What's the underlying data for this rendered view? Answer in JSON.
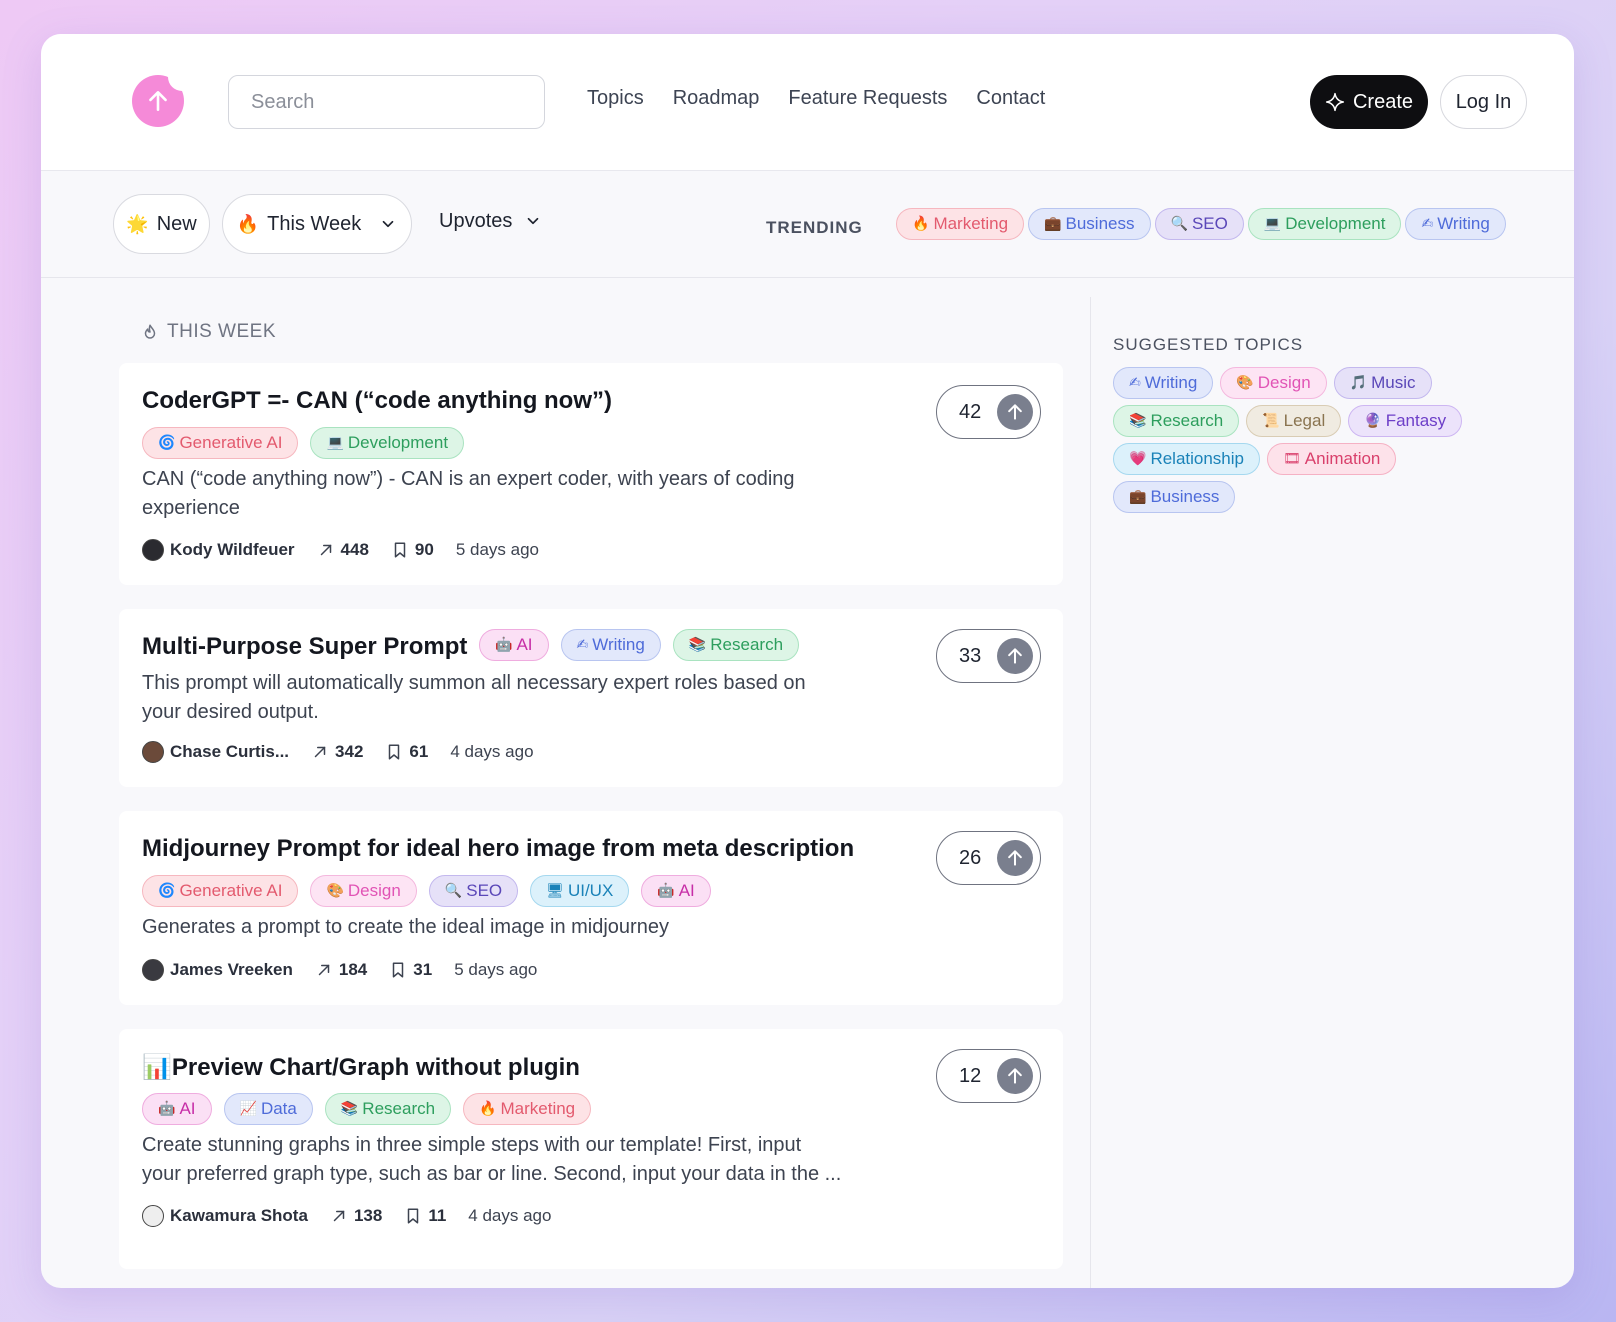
{
  "header": {
    "search_placeholder": "Search",
    "nav": [
      "Topics",
      "Roadmap",
      "Feature Requests",
      "Contact"
    ],
    "create_label": "Create",
    "login_label": "Log In"
  },
  "filters": {
    "new_label": "New",
    "new_emoji": "🌟",
    "week_label": "This Week",
    "week_emoji": "🔥",
    "sort_label": "Upvotes",
    "trending_label": "TRENDING",
    "trending": [
      {
        "emoji": "🔥",
        "label": "Marketing",
        "style": "t-red"
      },
      {
        "emoji": "💼",
        "label": "Business",
        "style": "t-blue"
      },
      {
        "emoji": "🔍",
        "label": "SEO",
        "style": "t-purple"
      },
      {
        "emoji": "💻",
        "label": "Development",
        "style": "t-green"
      },
      {
        "emoji": "✍",
        "label": "Writing",
        "style": "t-blue"
      }
    ]
  },
  "section_title": "THIS WEEK",
  "posts": [
    {
      "title": "CoderGPT =- CAN (“code anything now”)",
      "tags": [
        {
          "emoji": "🌀",
          "label": "Generative AI",
          "style": "t-red"
        },
        {
          "emoji": "💻",
          "label": "Development",
          "style": "t-green"
        }
      ],
      "description": "CAN (“code anything now”) - CAN is an expert coder, with years of coding experience",
      "author": "Kody Wildfeuer",
      "shares": "448",
      "saves": "90",
      "time": "5 days ago",
      "votes": "42"
    },
    {
      "title": "Multi-Purpose Super Prompt",
      "tags": [
        {
          "emoji": "🤖",
          "label": "AI",
          "style": "t-magenta"
        },
        {
          "emoji": "✍",
          "label": "Writing",
          "style": "t-blue"
        },
        {
          "emoji": "📚",
          "label": "Research",
          "style": "t-green"
        }
      ],
      "description": "This prompt will automatically summon all necessary expert roles based on your desired output.",
      "author": "Chase Curtis...",
      "shares": "342",
      "saves": "61",
      "time": "4 days ago",
      "votes": "33"
    },
    {
      "title": "Midjourney Prompt for ideal hero image from meta description",
      "tags": [
        {
          "emoji": "🌀",
          "label": "Generative AI",
          "style": "t-red"
        },
        {
          "emoji": "🎨",
          "label": "Design",
          "style": "t-pink"
        },
        {
          "emoji": "🔍",
          "label": "SEO",
          "style": "t-purple"
        },
        {
          "emoji": "🖥",
          "label": "UI/UX",
          "style": "t-cyan"
        },
        {
          "emoji": "🤖",
          "label": "AI",
          "style": "t-magenta"
        }
      ],
      "description": "Generates a prompt to create the ideal image in midjourney",
      "author": "James Vreeken",
      "shares": "184",
      "saves": "31",
      "time": "5 days ago",
      "votes": "26"
    },
    {
      "title": "📊Preview Chart/Graph without plugin",
      "tags": [
        {
          "emoji": "🤖",
          "label": "AI",
          "style": "t-magenta"
        },
        {
          "emoji": "📈",
          "label": "Data",
          "style": "t-blue"
        },
        {
          "emoji": "📚",
          "label": "Research",
          "style": "t-green"
        },
        {
          "emoji": "🔥",
          "label": "Marketing",
          "style": "t-red"
        }
      ],
      "description": "Create stunning graphs in three simple steps with our template! First, input your preferred graph type, such as bar or line. Second, input your data in the ...",
      "author": "Kawamura Shota",
      "shares": "138",
      "saves": "11",
      "time": "4 days ago",
      "votes": "12"
    }
  ],
  "sidebar": {
    "title": "SUGGESTED TOPICS",
    "rows": [
      [
        {
          "emoji": "✍",
          "label": "Writing",
          "style": "t-blue"
        },
        {
          "emoji": "🎨",
          "label": "Design",
          "style": "t-pink"
        },
        {
          "emoji": "🎵",
          "label": "Music",
          "style": "t-purple"
        }
      ],
      [
        {
          "emoji": "📚",
          "label": "Research",
          "style": "t-green"
        },
        {
          "emoji": "📜",
          "label": "Legal",
          "style": "t-tan"
        },
        {
          "emoji": "🔮",
          "label": "Fantasy",
          "style": "t-violet"
        }
      ],
      [
        {
          "emoji": "💗",
          "label": "Relationship",
          "style": "t-cyan"
        },
        {
          "emoji": "🎞",
          "label": "Animation",
          "style": "t-rose"
        }
      ],
      [
        {
          "emoji": "💼",
          "label": "Business",
          "style": "t-blue"
        }
      ]
    ]
  },
  "colors": {
    "logo": "#f58ad8",
    "create_bg": "#0e0e11",
    "vote_circle": "#7a7f8e"
  }
}
